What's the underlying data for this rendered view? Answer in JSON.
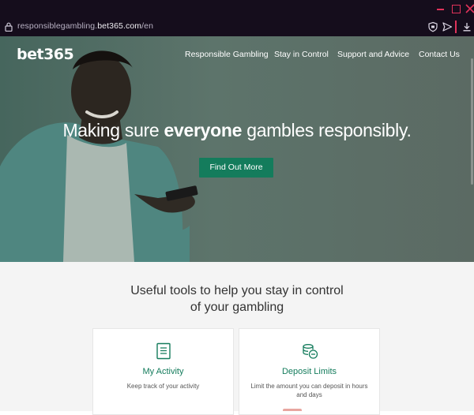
{
  "window": {
    "controls": [
      "minimize-icon",
      "maximize-icon",
      "close-icon"
    ],
    "accent": "#e0325a"
  },
  "browser": {
    "url_prefix": "responsiblegambling.",
    "url_domain": "bet365.com",
    "url_suffix": "/en",
    "icons": [
      "lock-icon",
      "shield-icon",
      "send-icon",
      "download-icon"
    ]
  },
  "hero": {
    "logo": "bet365",
    "nav": [
      "Responsible Gambling",
      "Stay in Control",
      "Support and Advice",
      "Contact Us"
    ],
    "headline_pre": "Making sure ",
    "headline_bold": "everyone",
    "headline_post": " gambles responsibly.",
    "cta": "Find Out More",
    "cta_color": "#147c5c",
    "background": "#5c6d66"
  },
  "tools": {
    "title_line1": "Useful tools to help you stay in control",
    "title_line2": "of your gambling",
    "cards": [
      {
        "icon": "document-icon",
        "title": "My Activity",
        "description": "Keep track of your activity"
      },
      {
        "icon": "coins-icon",
        "title": "Deposit Limits",
        "description": "Limit the amount you can deposit in hours and days"
      }
    ]
  }
}
